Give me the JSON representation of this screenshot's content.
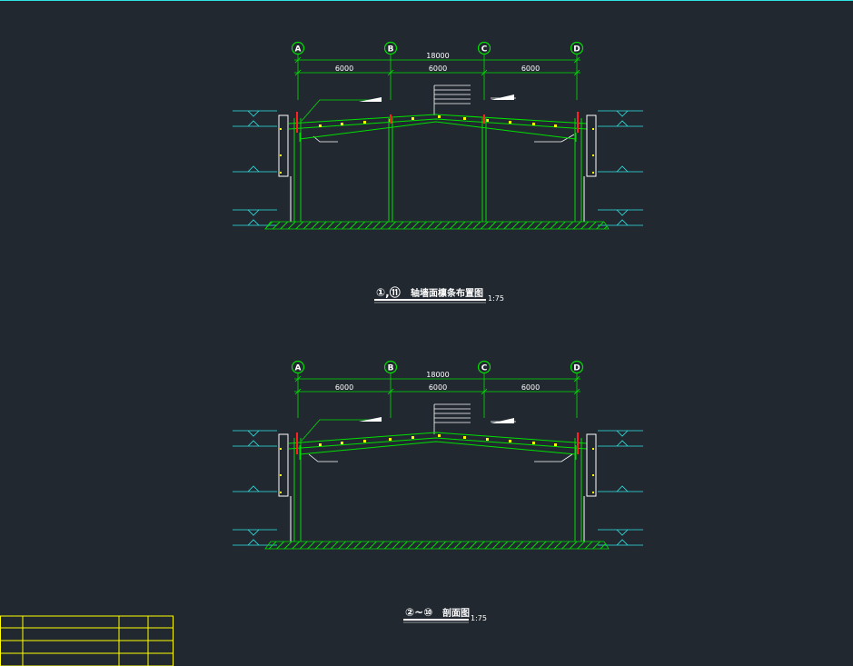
{
  "drawings": [
    {
      "axes": [
        "A",
        "B",
        "C",
        "D"
      ],
      "total_dimension": "18000",
      "bay_dimensions": [
        "6000",
        "6000",
        "6000"
      ],
      "title_symbols": "①,⑪",
      "title": "轴墙面檩条布置图",
      "scale": "1:75"
    },
    {
      "axes": [
        "A",
        "B",
        "C",
        "D"
      ],
      "total_dimension": "18000",
      "bay_dimensions": [
        "6000",
        "6000",
        "6000"
      ],
      "title_symbols": "②~⑩",
      "title": "剖面图",
      "scale": "1:75"
    }
  ],
  "colors": {
    "background": "#212830",
    "frame": "#2ee6e6",
    "member": "#00e000",
    "cyan": "#2ee6e6",
    "red": "#ff2020",
    "yellow": "#ffff00",
    "white": "#ffffff"
  }
}
